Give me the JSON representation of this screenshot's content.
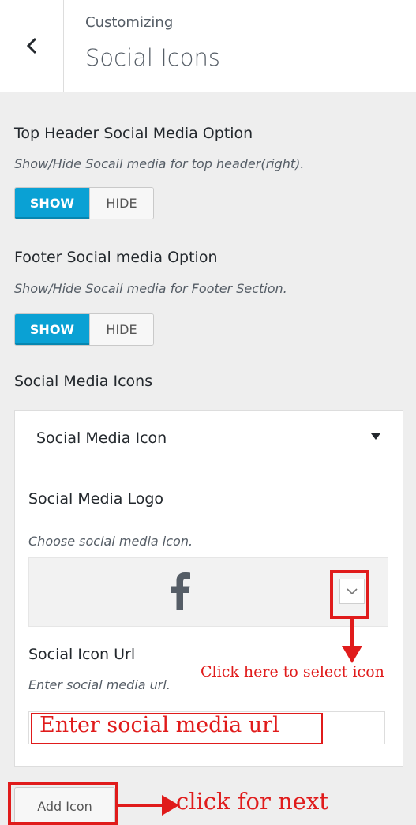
{
  "header": {
    "back_icon": "chevron-left-icon",
    "subtitle": "Customizing",
    "title": "Social Icons"
  },
  "top_header_option": {
    "title": "Top Header Social Media Option",
    "description": "Show/Hide Socail media for top header(right).",
    "show_label": "SHOW",
    "hide_label": "HIDE",
    "selected": "SHOW"
  },
  "footer_option": {
    "title": "Footer Social media Option",
    "description": "Show/Hide Socail media for Footer Section.",
    "show_label": "SHOW",
    "hide_label": "HIDE",
    "selected": "SHOW"
  },
  "social_icons": {
    "section_title": "Social Media Icons",
    "panel_title": "Social Media Icon",
    "logo_title": "Social Media Logo",
    "logo_description": "Choose social media icon.",
    "selected_icon": "facebook-icon",
    "url_title": "Social Icon Url",
    "url_description": "Enter social media url.",
    "url_value": ""
  },
  "add_button_label": "Add Icon",
  "annotations": {
    "select_note": "Click here to select icon",
    "url_note": "Enter social media url",
    "next_note": "click for next"
  },
  "colors": {
    "accent": "#0aa1d4",
    "annotation": "#e01b1b"
  }
}
